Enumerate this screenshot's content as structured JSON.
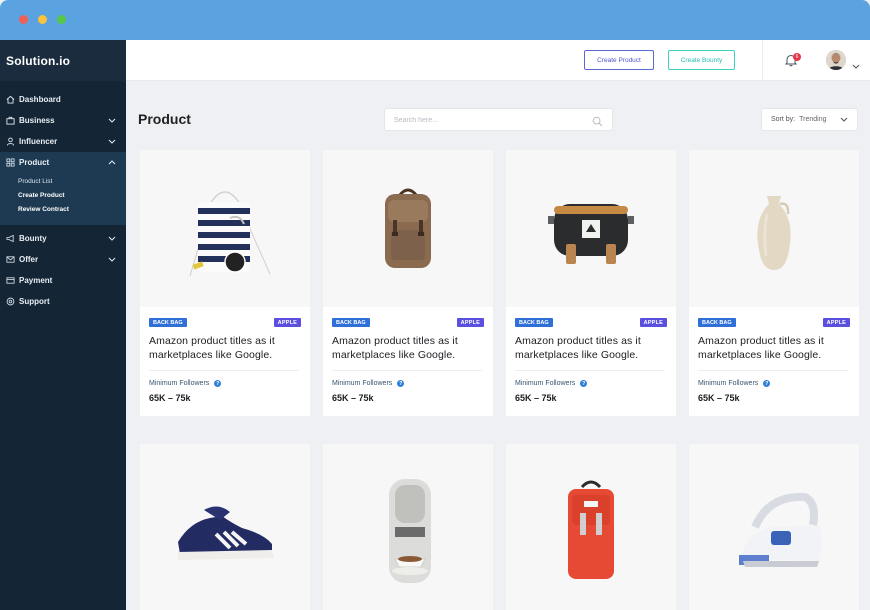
{
  "window": {
    "colors": {
      "titlebar": "#5ba3e0",
      "sidebar": "#142535"
    }
  },
  "sidebar": {
    "brand": "Solution.io",
    "items": [
      {
        "label": "Dashboard",
        "icon": "home-icon"
      },
      {
        "label": "Business",
        "icon": "briefcase-icon"
      },
      {
        "label": "Influencer",
        "icon": "user-icon"
      },
      {
        "label": "Product",
        "icon": "grid-icon"
      },
      {
        "label": "Bounty",
        "icon": "megaphone-icon"
      },
      {
        "label": "Offer",
        "icon": "envelope-icon"
      },
      {
        "label": "Payment",
        "icon": "card-icon"
      },
      {
        "label": "Support",
        "icon": "support-icon"
      }
    ],
    "product_sub": [
      "Product List",
      "Create Product",
      "Review Contract"
    ]
  },
  "topbar": {
    "create_product": "Create Product",
    "create_bounty": "Create Bounty",
    "notification_count": "6"
  },
  "main": {
    "title": "Product",
    "search_placeholder": "Search here...",
    "sort_label": "Sort by:",
    "sort_value": "Trending"
  },
  "cards": [
    {
      "image": "drawstring-bag",
      "category": "BACK BAG",
      "brand": "APPLE",
      "title": "Amazon product titles as it marketplaces like Google.",
      "followers_label": "Minimum Followers",
      "range": "65K – 75k"
    },
    {
      "image": "leather-backpack",
      "category": "BACK BAG",
      "brand": "APPLE",
      "title": "Amazon product titles as it marketplaces like Google.",
      "followers_label": "Minimum Followers",
      "range": "65K – 75k"
    },
    {
      "image": "waist-bag",
      "category": "BACK BAG",
      "brand": "APPLE",
      "title": "Amazon product titles as it marketplaces like Google.",
      "followers_label": "Minimum Followers",
      "range": "65K – 75k"
    },
    {
      "image": "vase",
      "category": "BACK BAG",
      "brand": "APPLE",
      "title": "Amazon product titles as it marketplaces like Google.",
      "followers_label": "Minimum Followers",
      "range": "65K – 75k"
    },
    {
      "image": "sneaker"
    },
    {
      "image": "coffee-machine"
    },
    {
      "image": "red-backpack"
    },
    {
      "image": "steam-iron"
    }
  ]
}
